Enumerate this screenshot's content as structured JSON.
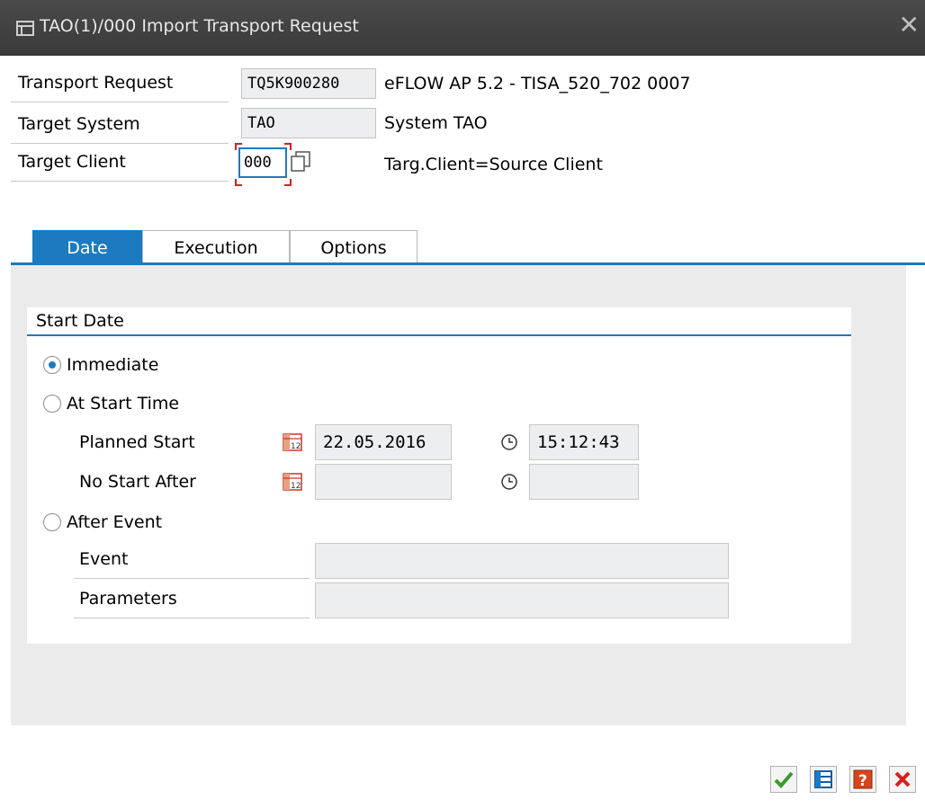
{
  "window": {
    "title": "TAO(1)/000 Import Transport Request",
    "close_symbol": "✕"
  },
  "header": {
    "transport_request": {
      "label": "Transport Request",
      "value": "TQ5K900280",
      "description": "eFLOW AP 5.2 - TISA_520_702 0007"
    },
    "target_system": {
      "label": "Target System",
      "value": "TAO",
      "description": "System TAO"
    },
    "target_client": {
      "label": "Target Client",
      "value": "000",
      "description": "Targ.Client=Source Client"
    }
  },
  "tabs": [
    {
      "label": "Date",
      "active": true
    },
    {
      "label": "Execution",
      "active": false
    },
    {
      "label": "Options",
      "active": false
    }
  ],
  "start_date": {
    "group_title": "Start Date",
    "options": [
      {
        "label": "Immediate",
        "selected": true
      },
      {
        "label": "At Start Time",
        "selected": false
      },
      {
        "label": "After Event",
        "selected": false
      }
    ],
    "planned_start": {
      "label": "Planned Start",
      "date": "22.05.2016",
      "time": "15:12:43"
    },
    "no_start_after": {
      "label": "No Start After",
      "date": "",
      "time": ""
    },
    "event": {
      "label": "Event",
      "value": ""
    },
    "parameters": {
      "label": "Parameters",
      "value": ""
    }
  },
  "footer_buttons": [
    {
      "name": "continue",
      "icon": "check-icon"
    },
    {
      "name": "schedule",
      "icon": "schedule-icon"
    },
    {
      "name": "help",
      "icon": "help-icon"
    },
    {
      "name": "cancel",
      "icon": "cancel-icon"
    }
  ],
  "colors": {
    "accent": "#1b7ac0",
    "titlebar": "#3f3f3f",
    "field_bg": "#eceef0",
    "content_bg": "#ebebeb"
  }
}
